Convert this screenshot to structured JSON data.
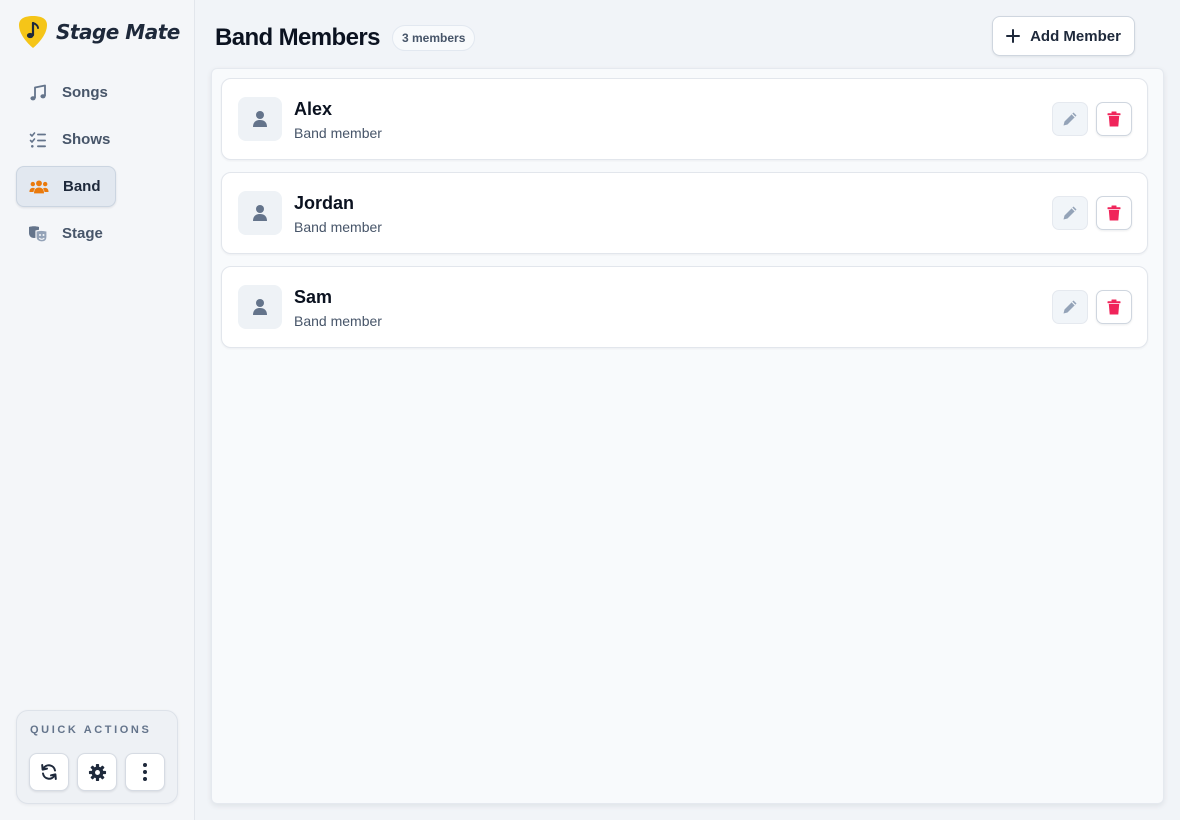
{
  "app": {
    "name": "Stage Mate",
    "logo_icon": "guitar-pick-note-icon",
    "accent_color": "#f5c518"
  },
  "sidebar": {
    "items": [
      {
        "label": "Songs",
        "icon": "music-note-icon",
        "active": false
      },
      {
        "label": "Shows",
        "icon": "checklist-icon",
        "active": false
      },
      {
        "label": "Band",
        "icon": "users-icon",
        "active": true,
        "icon_color": "#ea7a0c"
      },
      {
        "label": "Stage",
        "icon": "theater-masks-icon",
        "active": false
      }
    ],
    "quick_actions": {
      "title": "QUICK ACTIONS",
      "buttons": [
        {
          "icon": "refresh-icon"
        },
        {
          "icon": "gear-icon"
        },
        {
          "icon": "more-vertical-icon"
        }
      ]
    }
  },
  "header": {
    "title": "Band Members",
    "count_badge": "3 members",
    "add_button_label": "Add Member"
  },
  "members": [
    {
      "name": "Alex",
      "role": "Band member"
    },
    {
      "name": "Jordan",
      "role": "Band member"
    },
    {
      "name": "Sam",
      "role": "Band member"
    }
  ],
  "colors": {
    "delete": "#f0245a",
    "edit": "#94a3b8"
  }
}
